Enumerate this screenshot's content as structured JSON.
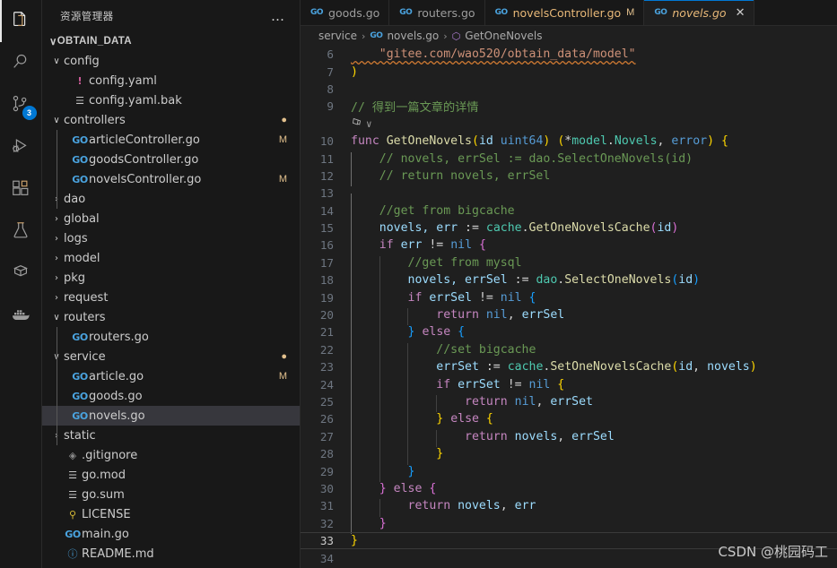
{
  "activity_bar": {
    "items": [
      {
        "name": "explorer",
        "icon": "files-icon",
        "active": true,
        "badge": ""
      },
      {
        "name": "search",
        "icon": "search-icon",
        "active": false,
        "badge": ""
      },
      {
        "name": "source-control",
        "icon": "source-control-icon",
        "active": false,
        "badge": "3"
      },
      {
        "name": "run-and-debug",
        "icon": "run-debug-icon",
        "active": false,
        "badge": ""
      },
      {
        "name": "extensions",
        "icon": "extensions-icon",
        "active": false,
        "badge": ""
      },
      {
        "name": "testing",
        "icon": "beaker-icon",
        "active": false,
        "badge": ""
      },
      {
        "name": "jupyter",
        "icon": "jupyter-icon",
        "active": false,
        "badge": ""
      },
      {
        "name": "docker",
        "icon": "docker-whale-icon",
        "active": false,
        "badge": ""
      }
    ]
  },
  "sidebar": {
    "title": "资源管理器",
    "actions_label": "…",
    "root": {
      "label": "OBTAIN_DATA",
      "twisty": "∨"
    },
    "tree": [
      {
        "label": "config",
        "type": "folder",
        "depth": 1,
        "twisty": "∨",
        "icon": "",
        "decor": ""
      },
      {
        "label": "config.yaml",
        "type": "yaml",
        "depth": 2,
        "twisty": "",
        "icon": "!",
        "decor": ""
      },
      {
        "label": "config.yaml.bak",
        "type": "list",
        "depth": 2,
        "twisty": "",
        "icon": "☰",
        "decor": ""
      },
      {
        "label": "controllers",
        "type": "folder",
        "depth": 1,
        "twisty": "∨",
        "icon": "",
        "decor": "●"
      },
      {
        "label": "articleController.go",
        "type": "go",
        "depth": 2,
        "twisty": "",
        "icon": "GO",
        "decor": "M"
      },
      {
        "label": "goodsController.go",
        "type": "go",
        "depth": 2,
        "twisty": "",
        "icon": "GO",
        "decor": ""
      },
      {
        "label": "novelsController.go",
        "type": "go",
        "depth": 2,
        "twisty": "",
        "icon": "GO",
        "decor": "M"
      },
      {
        "label": "dao",
        "type": "folder",
        "depth": 1,
        "twisty": "›",
        "icon": "",
        "decor": ""
      },
      {
        "label": "global",
        "type": "folder",
        "depth": 1,
        "twisty": "›",
        "icon": "",
        "decor": ""
      },
      {
        "label": "logs",
        "type": "folder",
        "depth": 1,
        "twisty": "›",
        "icon": "",
        "decor": ""
      },
      {
        "label": "model",
        "type": "folder",
        "depth": 1,
        "twisty": "›",
        "icon": "",
        "decor": ""
      },
      {
        "label": "pkg",
        "type": "folder",
        "depth": 1,
        "twisty": "›",
        "icon": "",
        "decor": ""
      },
      {
        "label": "request",
        "type": "folder",
        "depth": 1,
        "twisty": "›",
        "icon": "",
        "decor": ""
      },
      {
        "label": "routers",
        "type": "folder",
        "depth": 1,
        "twisty": "∨",
        "icon": "",
        "decor": ""
      },
      {
        "label": "routers.go",
        "type": "go",
        "depth": 2,
        "twisty": "",
        "icon": "GO",
        "decor": ""
      },
      {
        "label": "service",
        "type": "folder",
        "depth": 1,
        "twisty": "∨",
        "icon": "",
        "decor": "●"
      },
      {
        "label": "article.go",
        "type": "go",
        "depth": 2,
        "twisty": "",
        "icon": "GO",
        "decor": "M"
      },
      {
        "label": "goods.go",
        "type": "go",
        "depth": 2,
        "twisty": "",
        "icon": "GO",
        "decor": ""
      },
      {
        "label": "novels.go",
        "type": "go",
        "depth": 2,
        "twisty": "",
        "icon": "GO",
        "decor": "",
        "selected": true
      },
      {
        "label": "static",
        "type": "folder",
        "depth": 1,
        "twisty": "›",
        "icon": "",
        "decor": ""
      },
      {
        "label": ".gitignore",
        "type": "gitignore",
        "depth": 1,
        "twisty": "",
        "icon": "◈",
        "decor": ""
      },
      {
        "label": "go.mod",
        "type": "list",
        "depth": 1,
        "twisty": "",
        "icon": "☰",
        "decor": ""
      },
      {
        "label": "go.sum",
        "type": "list",
        "depth": 1,
        "twisty": "",
        "icon": "☰",
        "decor": ""
      },
      {
        "label": "LICENSE",
        "type": "license",
        "depth": 1,
        "twisty": "",
        "icon": "⚲",
        "decor": ""
      },
      {
        "label": "main.go",
        "type": "go",
        "depth": 1,
        "twisty": "",
        "icon": "GO",
        "decor": ""
      },
      {
        "label": "README.md",
        "type": "md",
        "depth": 1,
        "twisty": "",
        "icon": "ⓘ",
        "decor": ""
      }
    ]
  },
  "tabs": [
    {
      "label": "goods.go",
      "icon": "GO",
      "active": false,
      "modified": false,
      "badge": ""
    },
    {
      "label": "routers.go",
      "icon": "GO",
      "active": false,
      "modified": false,
      "badge": ""
    },
    {
      "label": "novelsController.go",
      "icon": "GO",
      "active": false,
      "modified": true,
      "badge": "M"
    },
    {
      "label": "novels.go",
      "icon": "GO",
      "active": true,
      "modified": false,
      "badge": "",
      "close": "✕"
    }
  ],
  "breadcrumb": {
    "items": [
      "service",
      "novels.go",
      "GetOneNovels"
    ],
    "separator": "›",
    "file_icon": "GO",
    "symbol_icon": "⬡"
  },
  "code": {
    "codelens": {
      "chevron": "∨",
      "row_after_line": 9
    },
    "lines": [
      {
        "n": "6",
        "segs": [
          {
            "t": "\"gitee.com/wao520/obtain_data/model\"",
            "c": "str err-underline",
            "indent": 1
          }
        ]
      },
      {
        "n": "7",
        "segs": [
          {
            "t": ")",
            "c": "b1"
          }
        ]
      },
      {
        "n": "8",
        "segs": []
      },
      {
        "n": "9",
        "segs": [
          {
            "t": "// 得到一篇文章的详情",
            "c": "cmt"
          }
        ]
      },
      {
        "n": "10",
        "segs": [
          {
            "t": "func ",
            "c": "kw"
          },
          {
            "t": "GetOneNovels",
            "c": "fn"
          },
          {
            "t": "(",
            "c": "b1"
          },
          {
            "t": "id ",
            "c": "var"
          },
          {
            "t": "uint64",
            "c": "kw2"
          },
          {
            "t": ")",
            "c": "b1"
          },
          {
            "t": " ",
            "c": "op"
          },
          {
            "t": "(",
            "c": "b1"
          },
          {
            "t": "*",
            "c": "op"
          },
          {
            "t": "model",
            "c": "typ"
          },
          {
            "t": ".",
            "c": "op"
          },
          {
            "t": "Novels",
            "c": "typ"
          },
          {
            "t": ", ",
            "c": "op"
          },
          {
            "t": "error",
            "c": "kw2"
          },
          {
            "t": ")",
            "c": "b1"
          },
          {
            "t": " ",
            "c": "op"
          },
          {
            "t": "{",
            "c": "b1"
          }
        ]
      },
      {
        "n": "11",
        "segs": [
          {
            "t": "    // novels, errSel := dao.SelectOneNovels(id)",
            "c": "cmt"
          }
        ]
      },
      {
        "n": "12",
        "segs": [
          {
            "t": "    // return novels, errSel",
            "c": "cmt"
          }
        ]
      },
      {
        "n": "13",
        "segs": []
      },
      {
        "n": "14",
        "segs": [
          {
            "t": "    //get from bigcache",
            "c": "cmt"
          }
        ]
      },
      {
        "n": "15",
        "segs": [
          {
            "t": "    novels, err ",
            "c": "var"
          },
          {
            "t": ":= ",
            "c": "op"
          },
          {
            "t": "cache",
            "c": "typ"
          },
          {
            "t": ".",
            "c": "op"
          },
          {
            "t": "GetOneNovelsCache",
            "c": "fn"
          },
          {
            "t": "(",
            "c": "b2"
          },
          {
            "t": "id",
            "c": "var"
          },
          {
            "t": ")",
            "c": "b2"
          }
        ]
      },
      {
        "n": "16",
        "segs": [
          {
            "t": "    ",
            "c": "op"
          },
          {
            "t": "if ",
            "c": "kw"
          },
          {
            "t": "err ",
            "c": "var"
          },
          {
            "t": "!= ",
            "c": "op"
          },
          {
            "t": "nil",
            "c": "kw2"
          },
          {
            "t": " ",
            "c": "op"
          },
          {
            "t": "{",
            "c": "b2"
          }
        ]
      },
      {
        "n": "17",
        "segs": [
          {
            "t": "        //get from mysql",
            "c": "cmt"
          }
        ]
      },
      {
        "n": "18",
        "segs": [
          {
            "t": "        novels, errSel ",
            "c": "var"
          },
          {
            "t": ":= ",
            "c": "op"
          },
          {
            "t": "dao",
            "c": "typ"
          },
          {
            "t": ".",
            "c": "op"
          },
          {
            "t": "SelectOneNovels",
            "c": "fn"
          },
          {
            "t": "(",
            "c": "b3"
          },
          {
            "t": "id",
            "c": "var"
          },
          {
            "t": ")",
            "c": "b3"
          }
        ]
      },
      {
        "n": "19",
        "segs": [
          {
            "t": "        ",
            "c": "op"
          },
          {
            "t": "if ",
            "c": "kw"
          },
          {
            "t": "errSel ",
            "c": "var"
          },
          {
            "t": "!= ",
            "c": "op"
          },
          {
            "t": "nil",
            "c": "kw2"
          },
          {
            "t": " ",
            "c": "op"
          },
          {
            "t": "{",
            "c": "b3"
          }
        ]
      },
      {
        "n": "20",
        "segs": [
          {
            "t": "            ",
            "c": "op"
          },
          {
            "t": "return ",
            "c": "kw"
          },
          {
            "t": "nil",
            "c": "kw2"
          },
          {
            "t": ", ",
            "c": "op"
          },
          {
            "t": "errSel",
            "c": "var"
          }
        ]
      },
      {
        "n": "21",
        "segs": [
          {
            "t": "        ",
            "c": "op"
          },
          {
            "t": "}",
            "c": "b3"
          },
          {
            "t": " ",
            "c": "op"
          },
          {
            "t": "else",
            "c": "kw"
          },
          {
            "t": " ",
            "c": "op"
          },
          {
            "t": "{",
            "c": "b3"
          }
        ]
      },
      {
        "n": "22",
        "segs": [
          {
            "t": "            //set bigcache",
            "c": "cmt"
          }
        ]
      },
      {
        "n": "23",
        "segs": [
          {
            "t": "            errSet ",
            "c": "var"
          },
          {
            "t": ":= ",
            "c": "op"
          },
          {
            "t": "cache",
            "c": "typ"
          },
          {
            "t": ".",
            "c": "op"
          },
          {
            "t": "SetOneNovelsCache",
            "c": "fn"
          },
          {
            "t": "(",
            "c": "b1"
          },
          {
            "t": "id",
            "c": "var"
          },
          {
            "t": ", ",
            "c": "op"
          },
          {
            "t": "novels",
            "c": "var"
          },
          {
            "t": ")",
            "c": "b1"
          }
        ]
      },
      {
        "n": "24",
        "segs": [
          {
            "t": "            ",
            "c": "op"
          },
          {
            "t": "if ",
            "c": "kw"
          },
          {
            "t": "errSet ",
            "c": "var"
          },
          {
            "t": "!= ",
            "c": "op"
          },
          {
            "t": "nil",
            "c": "kw2"
          },
          {
            "t": " ",
            "c": "op"
          },
          {
            "t": "{",
            "c": "b1"
          }
        ]
      },
      {
        "n": "25",
        "segs": [
          {
            "t": "                ",
            "c": "op"
          },
          {
            "t": "return ",
            "c": "kw"
          },
          {
            "t": "nil",
            "c": "kw2"
          },
          {
            "t": ", ",
            "c": "op"
          },
          {
            "t": "errSet",
            "c": "var"
          }
        ]
      },
      {
        "n": "26",
        "segs": [
          {
            "t": "            ",
            "c": "op"
          },
          {
            "t": "}",
            "c": "b1"
          },
          {
            "t": " ",
            "c": "op"
          },
          {
            "t": "else",
            "c": "kw"
          },
          {
            "t": " ",
            "c": "op"
          },
          {
            "t": "{",
            "c": "b1"
          }
        ]
      },
      {
        "n": "27",
        "segs": [
          {
            "t": "                ",
            "c": "op"
          },
          {
            "t": "return ",
            "c": "kw"
          },
          {
            "t": "novels",
            "c": "var"
          },
          {
            "t": ", ",
            "c": "op"
          },
          {
            "t": "errSel",
            "c": "var"
          }
        ]
      },
      {
        "n": "28",
        "segs": [
          {
            "t": "            ",
            "c": "op"
          },
          {
            "t": "}",
            "c": "b1"
          }
        ]
      },
      {
        "n": "29",
        "segs": [
          {
            "t": "        ",
            "c": "op"
          },
          {
            "t": "}",
            "c": "b3"
          }
        ]
      },
      {
        "n": "30",
        "segs": [
          {
            "t": "    ",
            "c": "op"
          },
          {
            "t": "}",
            "c": "b2"
          },
          {
            "t": " ",
            "c": "op"
          },
          {
            "t": "else",
            "c": "kw"
          },
          {
            "t": " ",
            "c": "op"
          },
          {
            "t": "{",
            "c": "b2"
          }
        ]
      },
      {
        "n": "31",
        "segs": [
          {
            "t": "        ",
            "c": "op"
          },
          {
            "t": "return ",
            "c": "kw"
          },
          {
            "t": "novels",
            "c": "var"
          },
          {
            "t": ", ",
            "c": "op"
          },
          {
            "t": "err",
            "c": "var"
          }
        ]
      },
      {
        "n": "32",
        "segs": [
          {
            "t": "    ",
            "c": "op"
          },
          {
            "t": "}",
            "c": "b2"
          }
        ]
      },
      {
        "n": "33",
        "segs": [
          {
            "t": "}",
            "c": "b1"
          }
        ],
        "current": true
      },
      {
        "n": "34",
        "segs": []
      }
    ]
  },
  "watermark": "CSDN @桃园码工"
}
